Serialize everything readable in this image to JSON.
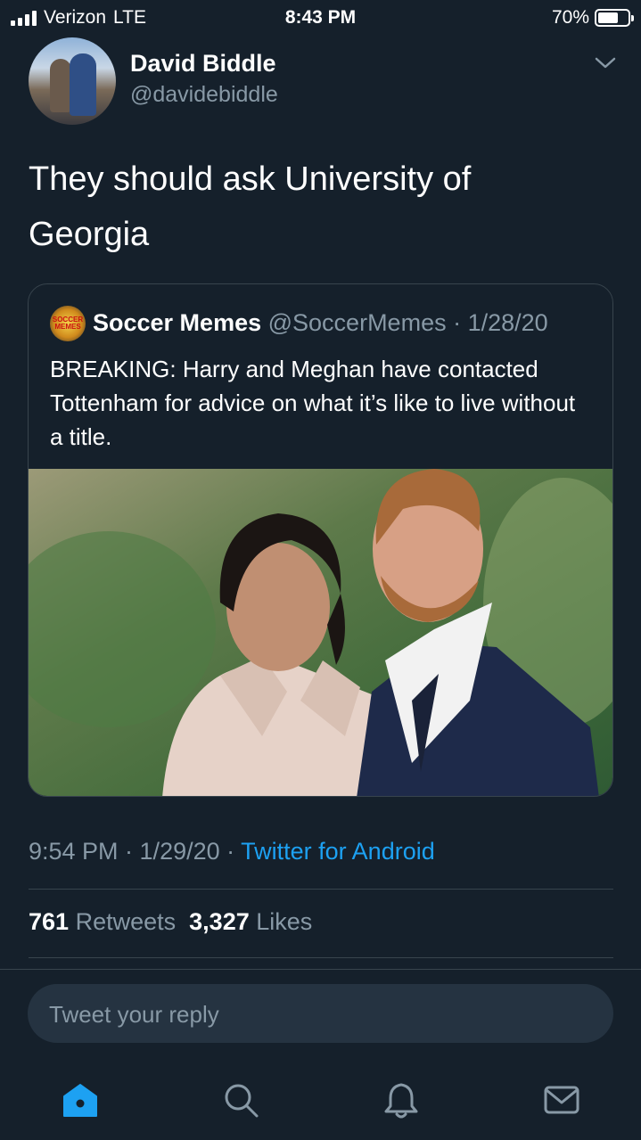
{
  "status_bar": {
    "carrier": "Verizon",
    "network": "LTE",
    "time": "8:43 PM",
    "battery": "70%",
    "battery_level": 0.7
  },
  "tweet": {
    "author_name": "David Biddle",
    "author_handle": "@davidebiddle",
    "text": "They should ask University of Georgia",
    "timestamp": "9:54 PM · 1/29/20 · ",
    "source": "Twitter for Android"
  },
  "quoted_tweet": {
    "author_name": "Soccer Memes",
    "meta": "@SoccerMemes · 1/28/20",
    "text": "BREAKING: Harry and Meghan have contacted Tottenham for advice on what it’s like to live without a title.",
    "avatar_text": "SOCCER MEMES"
  },
  "stats": {
    "retweets_count": "761",
    "retweets_label": "Retweets",
    "likes_count": "3,327",
    "likes_label": "Likes"
  },
  "reply": {
    "placeholder": "Tweet your reply"
  },
  "tab_bar": {
    "items": [
      "home-icon",
      "search-icon",
      "notifications-icon",
      "messages-icon"
    ],
    "active_color": "#1da1f2"
  },
  "colors": {
    "background": "#15202b",
    "secondary_text": "#8899a6",
    "accent": "#1da1f2",
    "border": "#38444d"
  }
}
